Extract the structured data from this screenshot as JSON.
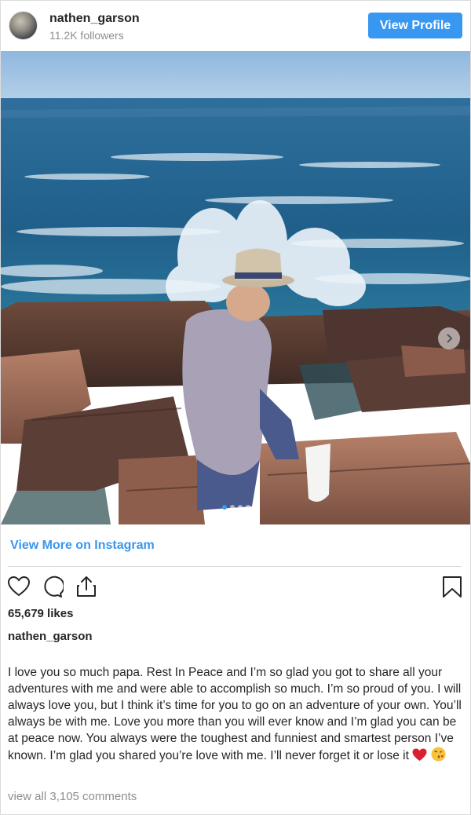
{
  "header": {
    "username": "nathen_garson",
    "followers": "11.2K followers",
    "view_profile_label": "View Profile"
  },
  "post": {
    "image_description_icon": "photo",
    "carousel": {
      "count": 4,
      "active_index": 0
    }
  },
  "view_more_label": "View More on Instagram",
  "actions": {
    "like_icon": "heart-icon",
    "comment_icon": "comment-icon",
    "share_icon": "share-icon",
    "save_icon": "bookmark-icon"
  },
  "likes": "65,679 likes",
  "caption": {
    "username": "nathen_garson",
    "text": "I love you so much papa. Rest In Peace and I’m so glad you got to share all your adventures with me and were able to accomplish so much. I’m so proud of you. I will always love you, but I think it’s time for you to go on an adventure of your own. You’ll always be with me. Love you more than you will ever know and I’m glad you can be at peace now. You always were the toughest and funniest and smartest person I’ve known. I’m glad you shared you’re love with me. I’ll never forget it or lose it",
    "emojis": [
      "heart-emoji",
      "kiss-face-emoji"
    ]
  },
  "comments_label": "view all 3,105 comments",
  "colors": {
    "accent": "#3897f0",
    "text": "#262626",
    "muted": "#8e8e8e",
    "divider": "#dbdbdb"
  }
}
